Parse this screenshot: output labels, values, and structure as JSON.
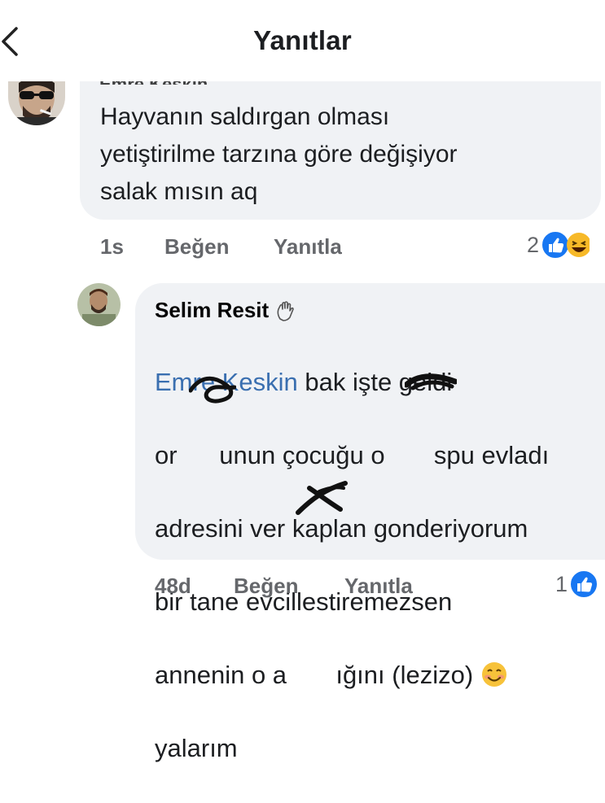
{
  "header": {
    "title": "Yanıtlar"
  },
  "comment1": {
    "author_partial": "Emre Keskin",
    "text": "Hayvanın saldırgan olması\nyetiştirilme tarzına göre değişiyor\nsalak mısın aq",
    "time": "1s",
    "like_label": "Beğen",
    "reply_label": "Yanıtla",
    "reaction_count": "2"
  },
  "reply1": {
    "author": "Selim Resit",
    "mention": "Emre Keskin",
    "text_line1_rest": " bak işte geldi",
    "text_line2": "or      unun çocuğu o       spu evladı",
    "text_line3": "adresini ver kaplan gonderiyorum",
    "text_line4": "bir tane evcillestiremezsen",
    "text_line5": "annenin o a       ığını (lezizo) ",
    "text_line6": "yalarım",
    "time": "48d",
    "like_label": "Beğen",
    "reply_label": "Yanıtla",
    "reaction_count": "1"
  },
  "colors": {
    "bubble": "#f0f2f5",
    "action_text": "#65676b",
    "mention": "#3a6fb0",
    "like_blue": "#1877f2"
  }
}
